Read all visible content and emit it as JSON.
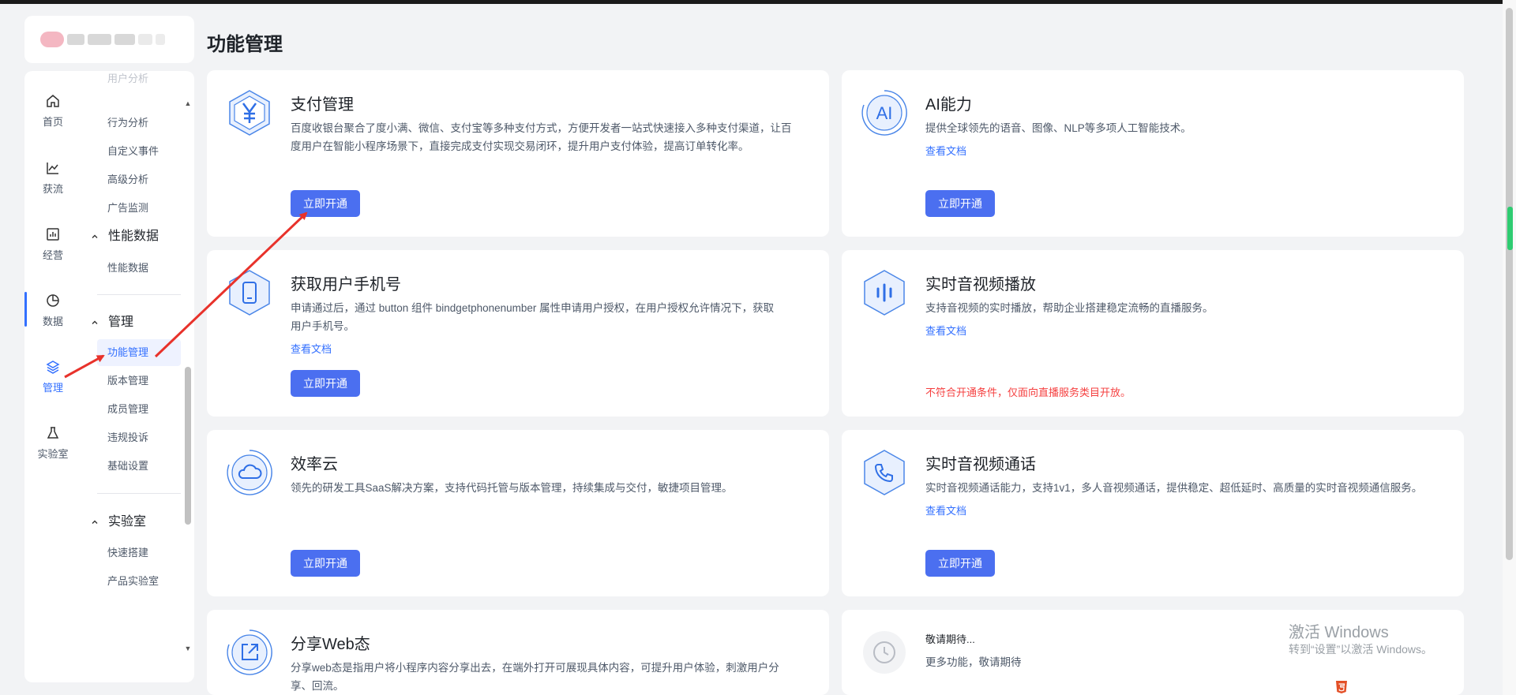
{
  "page": {
    "title": "功能管理"
  },
  "rail": {
    "items": [
      {
        "label": "首页",
        "icon": "home-icon"
      },
      {
        "label": "获流",
        "icon": "chart-line-icon"
      },
      {
        "label": "经营",
        "icon": "bar-chart-icon"
      },
      {
        "label": "数据",
        "icon": "pie-chart-icon"
      },
      {
        "label": "管理",
        "icon": "layers-icon",
        "active": true
      },
      {
        "label": "实验室",
        "icon": "flask-icon"
      }
    ]
  },
  "submenu": {
    "cut_item": "用户分析",
    "data_items": [
      "行为分析",
      "自定义事件",
      "高级分析",
      "广告监测"
    ],
    "performance_group": "性能数据",
    "performance_items": [
      "性能数据"
    ],
    "manage_group": "管理",
    "manage_items": [
      "功能管理",
      "版本管理",
      "成员管理",
      "违规投诉",
      "基础设置"
    ],
    "lab_group": "实验室",
    "lab_items": [
      "快速搭建",
      "产品实验室"
    ]
  },
  "cards": [
    {
      "title": "支付管理",
      "desc_lines": [
        "百度收银台聚合了度小满、微信、支付宝等多种支付方式，方便开发者一站式快速接入多种支付渠道，让百",
        "度用户在智能小程序场景下，直接完成支付实现交易闭环，提升用户支付体验，提高订单转化率。"
      ],
      "button": "立即开通",
      "icon": "yuan-icon"
    },
    {
      "title": "AI能力",
      "desc_lines": [
        "提供全球领先的语音、图像、NLP等多项人工智能技术。"
      ],
      "link": "查看文档",
      "button": "立即开通",
      "icon": "ai-icon"
    },
    {
      "title": "获取用户手机号",
      "desc_lines": [
        "申请通过后，通过 button 组件 bindgetphonenumber 属性申请用户授权，在用户授权允许情况下，获取",
        "用户手机号。"
      ],
      "link": "查看文档",
      "button": "立即开通",
      "icon": "phone-icon"
    },
    {
      "title": "实时音视频播放",
      "desc_lines": [
        "支持音视频的实时播放，帮助企业搭建稳定流畅的直播服务。"
      ],
      "link": "查看文档",
      "warning": "不符合开通条件，仅面向直播服务类目开放。",
      "icon": "audio-wave-icon"
    },
    {
      "title": "效率云",
      "desc_lines": [
        "领先的研发工具SaaS解决方案，支持代码托管与版本管理，持续集成与交付，敏捷项目管理。"
      ],
      "button": "立即开通",
      "icon": "cloud-icon"
    },
    {
      "title": "实时音视频通话",
      "desc_lines": [
        "实时音视频通话能力，支持1v1，多人音视频通话，提供稳定、超低延时、高质量的实时音视频通信服务。"
      ],
      "link": "查看文档",
      "button": "立即开通",
      "icon": "call-icon"
    },
    {
      "title": "分享Web态",
      "desc_lines": [
        "分享web态是指用户将小程序内容分享出去，在端外打开可展现具体内容，可提升用户体验，刺激用户分",
        "享、回流。"
      ],
      "icon": "share-icon"
    },
    {
      "title": "敬请期待...",
      "desc_lines": [
        "更多功能，敬请期待"
      ],
      "icon": "clock-icon"
    }
  ],
  "watermark": {
    "line1": "激活 Windows",
    "line2": "转到“设置”以激活 Windows。"
  },
  "colors": {
    "accent": "#3370ff",
    "button": "#4b6ff0",
    "warning": "#f53f3f",
    "annotation_arrow": "#e8322b"
  }
}
